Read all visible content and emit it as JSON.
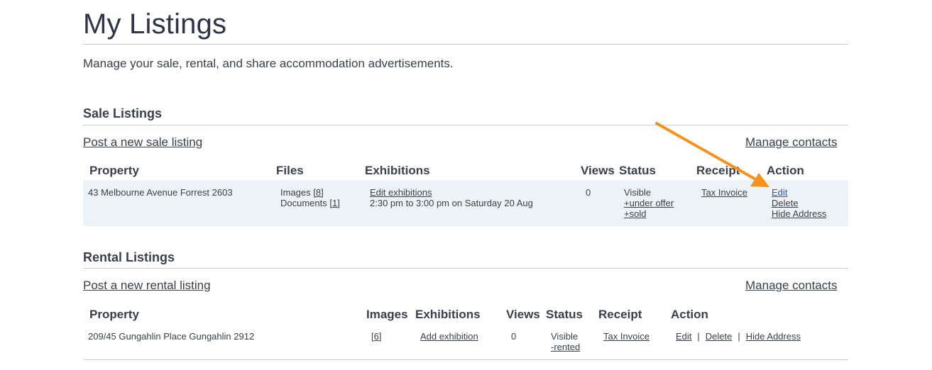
{
  "page": {
    "title": "My Listings",
    "intro": "Manage your sale, rental, and share accommodation advertisements."
  },
  "sale": {
    "title": "Sale Listings",
    "post_link": "Post a new sale listing",
    "manage_link": "Manage contacts",
    "headers": {
      "property": "Property",
      "files": "Files",
      "exhibitions": "Exhibitions",
      "views": "Views",
      "status": "Status",
      "receipt": "Receipt",
      "action": "Action"
    },
    "rows": [
      {
        "property": "43 Melbourne Avenue Forrest 2603",
        "images_label": "Images",
        "images_count": "[8]",
        "documents_label": "Documents",
        "documents_count": "[1]",
        "exhibition_link": "Edit exhibitions",
        "exhibition_time": "2:30 pm to 3:00 pm on Saturday 20 Aug",
        "views": "0",
        "status": "Visible",
        "status_link_1": "+under offer",
        "status_link_2": "+sold",
        "receipt": "Tax Invoice",
        "action_edit": "Edit",
        "action_delete": "Delete",
        "action_hide": "Hide Address"
      }
    ]
  },
  "rental": {
    "title": "Rental Listings",
    "post_link": "Post a new rental listing",
    "manage_link": "Manage contacts",
    "headers": {
      "property": "Property",
      "images": "Images",
      "exhibitions": "Exhibitions",
      "views": "Views",
      "status": "Status",
      "receipt": "Receipt",
      "action": "Action"
    },
    "rows": [
      {
        "property": "209/45 Gungahlin Place Gungahlin 2912",
        "images_count": "[6]",
        "exhibition_link": "Add exhibition",
        "views": "0",
        "status": "Visible",
        "status_link": "-rented",
        "receipt": "Tax Invoice",
        "action_edit": "Edit",
        "action_delete": "Delete",
        "action_hide": "Hide Address",
        "separator": "|"
      }
    ]
  },
  "annotation": {
    "arrow_color": "#f5921e",
    "icon": "arrow-pointer"
  }
}
